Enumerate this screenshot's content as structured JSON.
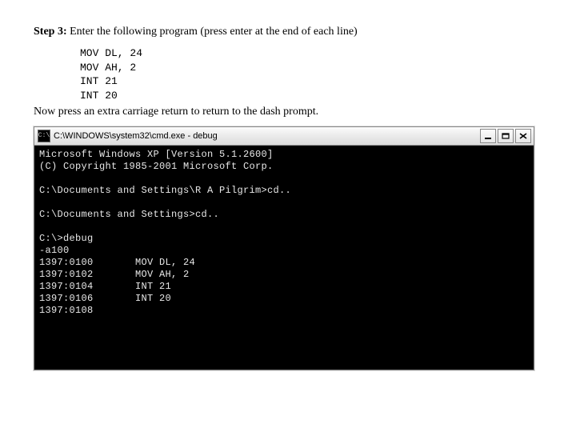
{
  "step": {
    "label": "Step 3:",
    "instruction": "Enter the following program (press enter at the end of each line)"
  },
  "code": {
    "l1": "MOV DL, 24",
    "l2": "MOV AH, 2",
    "l3": "INT 21",
    "l4": "INT 20"
  },
  "after": "Now press an extra carriage return to return to the dash prompt.",
  "window": {
    "icon_text": "C:\\",
    "title": "C:\\WINDOWS\\system32\\cmd.exe - debug"
  },
  "console": {
    "l01": "Microsoft Windows XP [Version 5.1.2600]",
    "l02": "(C) Copyright 1985-2001 Microsoft Corp.",
    "l03": "",
    "l04": "C:\\Documents and Settings\\R A Pilgrim>cd..",
    "l05": "",
    "l06": "C:\\Documents and Settings>cd..",
    "l07": "",
    "l08": "C:\\>debug",
    "l09": "-a100",
    "l10": "1397:0100       MOV DL, 24",
    "l11": "1397:0102       MOV AH, 2",
    "l12": "1397:0104       INT 21",
    "l13": "1397:0106       INT 20",
    "l14": "1397:0108"
  }
}
